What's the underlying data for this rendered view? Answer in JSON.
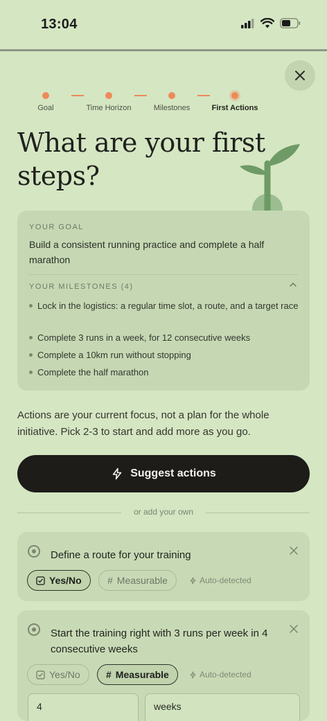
{
  "status_bar": {
    "time": "13:04"
  },
  "stepper": {
    "steps": [
      {
        "label": "Goal"
      },
      {
        "label": "Time Horizon"
      },
      {
        "label": "Milestones"
      },
      {
        "label": "First Actions"
      }
    ],
    "current_index": 3
  },
  "title": "What are your first steps?",
  "summary": {
    "goal_label": "YOUR GOAL",
    "goal_text": "Build a consistent running practice and complete a half marathon",
    "milestones_label": "YOUR MILESTONES (4)",
    "milestones": [
      "Lock in the logistics: a regular time slot, a route, and a target race",
      "Complete 3 runs in a week, for 12 consecutive weeks",
      "Complete a 10km run without stopping",
      "Complete the half marathon"
    ]
  },
  "intro_text": "Actions are your current focus, not a plan for the whole initiative. Pick 2-3 to start and add more as you go.",
  "suggest_button": {
    "label": "Suggest actions",
    "icon": "lightning-icon"
  },
  "divider_text": "or add your own",
  "actions": [
    {
      "title": "Define a route for your training",
      "type_yes_no": "Yes/No",
      "type_measurable": "Measurable",
      "selected_type": "Yes/No",
      "auto_detected": "Auto-detected"
    },
    {
      "title": "Start the training right with 3 runs per week in 4 consecutive weeks",
      "type_yes_no": "Yes/No",
      "type_measurable": "Measurable",
      "selected_type": "Measurable",
      "auto_detected": "Auto-detected",
      "target_value": "4",
      "target_unit": "weeks"
    }
  ],
  "colors": {
    "background": "#d5e6c2",
    "card": "#c5d8b3",
    "step_accent": "#ee8a5a",
    "primary_button": "#1d1c19",
    "sprout": "#6e9a66"
  }
}
